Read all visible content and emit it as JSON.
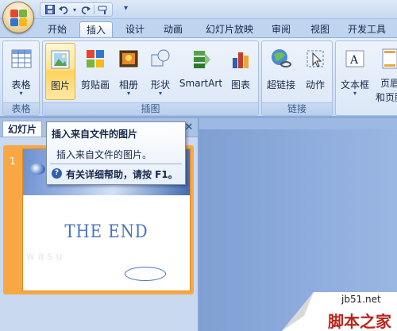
{
  "quick_access": {
    "items": [
      "save-icon",
      "undo-icon",
      "redo-icon",
      "format-painter-icon"
    ],
    "more_label": "▾"
  },
  "tabs": [
    {
      "label": "开始",
      "active": false
    },
    {
      "label": "插入",
      "active": true
    },
    {
      "label": "设计",
      "active": false
    },
    {
      "label": "动画",
      "active": false
    },
    {
      "label": "幻灯片放映",
      "active": false
    },
    {
      "label": "审阅",
      "active": false
    },
    {
      "label": "视图",
      "active": false
    },
    {
      "label": "开发工具",
      "active": false
    }
  ],
  "ribbon": {
    "groups": [
      {
        "label": "表格",
        "buttons": [
          {
            "label": "表格",
            "icon": "table-icon",
            "dropdown": true
          }
        ]
      },
      {
        "label": "插图",
        "buttons": [
          {
            "label": "图片",
            "icon": "picture-icon",
            "hover": true
          },
          {
            "label": "剪贴画",
            "icon": "clipart-icon"
          },
          {
            "label": "相册",
            "icon": "photo-album-icon",
            "dropdown": true
          },
          {
            "label": "形状",
            "icon": "shapes-icon",
            "dropdown": true
          },
          {
            "label": "SmartArt",
            "icon": "smartart-icon"
          },
          {
            "label": "图表",
            "icon": "chart-icon"
          }
        ]
      },
      {
        "label": "链接",
        "buttons": [
          {
            "label": "超链接",
            "icon": "hyperlink-icon"
          },
          {
            "label": "动作",
            "icon": "action-icon"
          }
        ]
      },
      {
        "label": "",
        "buttons": [
          {
            "label": "文本框",
            "icon": "textbox-icon",
            "dropdown": true
          },
          {
            "label": "页眉",
            "label2": "和页脚",
            "icon": "header-footer-icon"
          }
        ]
      }
    ]
  },
  "left_pane": {
    "tab_label": "幻灯片",
    "close_label": "✕",
    "slide_number": "1"
  },
  "slide": {
    "title": "THE END",
    "watermark": "wasu"
  },
  "tooltip": {
    "title": "插入来自文件的图片",
    "description": "插入来自文件的图片。",
    "help_icon": "?",
    "help_text": "有关详细帮助，请按 F1。"
  },
  "watermark": {
    "site": "jb51.net",
    "brand": "脚本之家"
  },
  "colors": {
    "hover_gold": "#ffd35c",
    "selection_orange": "#f7a844",
    "ribbon_blue": "#d6e4f6"
  }
}
